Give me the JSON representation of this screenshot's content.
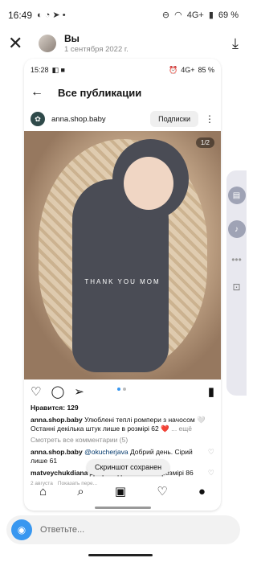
{
  "os_status": {
    "time": "16:49",
    "battery": "69 %",
    "signal": "4G+"
  },
  "story": {
    "sender": "Вы",
    "date": "1 сентября 2022 г."
  },
  "inner": {
    "status": {
      "time": "15:28",
      "network": "4G+",
      "battery": "85 %"
    },
    "nav_title": "Все публикации",
    "account": {
      "handle": "anna.shop.baby",
      "subscribe_label": "Подписки"
    },
    "photo": {
      "overlay_text": "THANK YOU MOM",
      "counter": "1/2"
    },
    "likes": "Нравится: 129",
    "caption": {
      "user": "anna.shop.baby",
      "text": "Улюблені теплі ромпери з начосом 🤍 Останні декілька штук лише в розмірі 62",
      "more": "... ещё"
    },
    "view_comments": "Смотреть все комментарии (5)",
    "comments": [
      {
        "user": "anna.shop.baby",
        "mention": "@okucherjava",
        "text": "Добрий день. Сірий лише 61"
      },
      {
        "user": "matveychukdiana",
        "text": "Доброго дня 6 такий в розмірі 86"
      }
    ],
    "meta": {
      "date": "2 августа",
      "action": "Показать пере..."
    },
    "toast": "Скриншот сохранен"
  },
  "reply": {
    "placeholder": "Ответьте..."
  },
  "colors": {
    "accent": "#3897f0",
    "like_red": "#e0245e",
    "side_handle": "#e8e8ef"
  }
}
